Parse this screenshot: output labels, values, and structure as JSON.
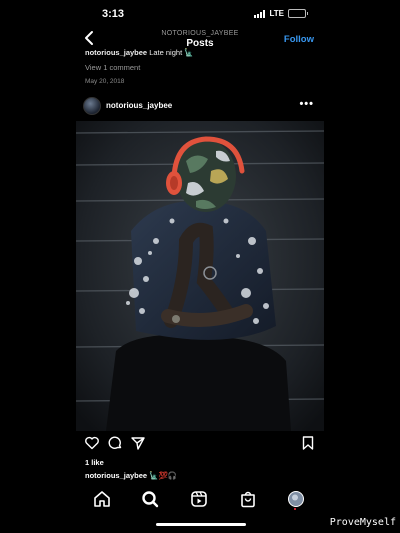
{
  "status_bar": {
    "time": "3:13",
    "network": "LTE"
  },
  "header": {
    "username": "NOTORIOUS_JAYBEE",
    "title": "Posts",
    "follow_label": "Follow",
    "back_icon": "chevron-left-icon"
  },
  "previous_post": {
    "caption_user": "notorious_jaybee",
    "caption_text": "Late night 🗽",
    "comments_link": "View 1 comment",
    "date": "May 20, 2018"
  },
  "post": {
    "username": "notorious_jaybee",
    "more_icon": "•••",
    "likes": "1 like",
    "caption_user": "notorious_jaybee",
    "caption_text": "🗽💯🎧",
    "icons": [
      "heart-icon",
      "comment-icon",
      "share-icon",
      "bookmark-icon"
    ]
  },
  "nav": {
    "items": [
      "home-icon",
      "search-icon",
      "reels-icon",
      "shop-icon",
      "profile-avatar"
    ]
  },
  "watermark": "ProveMyself",
  "colors": {
    "accent": "#3897f0",
    "background": "#000000",
    "notification_dot": "#ff3040",
    "headphones": "#e0523c"
  }
}
